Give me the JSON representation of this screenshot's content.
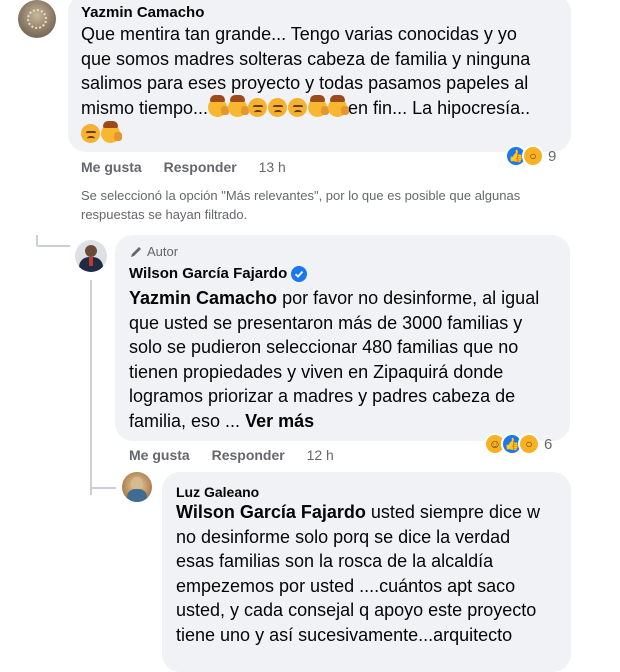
{
  "comment1": {
    "author": "Yazmin Camacho",
    "line1": "Que mentira tan grande... Tengo varias conocidas y yo",
    "line2": "que somos madres solteras cabeza de familia y ninguna",
    "line3": "salimos para eses proyecto y todas pasamos papeles al",
    "line4_text": "mismo tiempo...",
    "line4_after": "en fin... La hipocresía..",
    "emoji_row_line4": [
      "facepalm",
      "facepalm",
      "angry",
      "angry",
      "angry",
      "facepalm",
      "facepalm"
    ],
    "emoji_row_line5": [
      "angry",
      "facepalm"
    ],
    "like_label": "Me gusta",
    "reply_label": "Responder",
    "time": "13 h",
    "reactions": [
      "like",
      "wow"
    ],
    "reaction_count": "9"
  },
  "filter_notice": {
    "line1": "Se seleccionó la opción \"Más relevantes\", por lo que es posible que algunas",
    "line2": "respuestas se hayan filtrado."
  },
  "reply1": {
    "badge": "Autor",
    "author": "Wilson García Fajardo",
    "mention": "Yazmin Camacho",
    "line1_rest": " por favor no desinforme, al igual",
    "line2": "que usted se presentaron más de 3000 familias y",
    "line3": "solo se pudieron seleccionar 480 familias que no",
    "line4": "tienen propiedades y viven en Zipaquirá donde",
    "line5": "logramos priorizar a madres y padres cabeza de",
    "line6": "familia, eso ...",
    "see_more": "Ver más",
    "like_label": "Me gusta",
    "reply_label": "Responder",
    "time": "12 h",
    "reactions": [
      "haha",
      "like",
      "wow"
    ],
    "reaction_count": "6"
  },
  "reply2": {
    "author": "Luz Galeano",
    "mention": "Wilson García Fajardo",
    "line1_rest": " usted siempre dice w",
    "line2": "no desinforme solo porq se dice la verdad",
    "line3": "esas familias son la rosca de la alcaldía",
    "line4": "empezemos por usted ....cuántos apt saco",
    "line5": "usted, y cada consejal q apoyo este proyecto",
    "line6": "tiene uno y así sucesivamente...arquitecto"
  }
}
